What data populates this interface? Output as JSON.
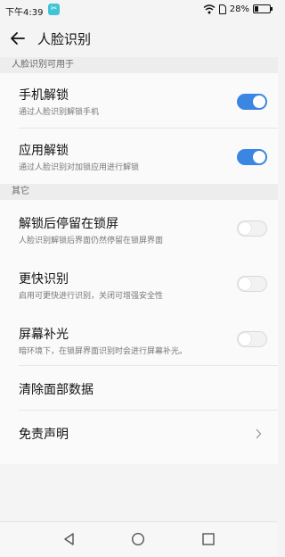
{
  "status_bar": {
    "time": "下午4:39",
    "app_icon_glyph": "✂",
    "battery_percent_text": "28%",
    "battery_level": 0.28
  },
  "header": {
    "title": "人脸识别"
  },
  "sections": [
    {
      "header": "人脸识别可用于"
    },
    {
      "header": "其它"
    }
  ],
  "rows": {
    "phone_unlock": {
      "title": "手机解锁",
      "subtitle": "通过人脸识别解锁手机",
      "enabled": true
    },
    "app_unlock": {
      "title": "应用解锁",
      "subtitle": "通过人脸识别对加锁应用进行解锁",
      "enabled": true
    },
    "stay_on_lockscreen": {
      "title": "解锁后停留在锁屏",
      "subtitle": "人脸识别解锁后界面仍然停留在锁屏界面",
      "enabled": false
    },
    "faster_recognition": {
      "title": "更快识别",
      "subtitle": "启用可更快进行识别，关闭可增强安全性",
      "enabled": false
    },
    "screen_fill_light": {
      "title": "屏幕补光",
      "subtitle": "暗环境下，在锁屏界面识别时会进行屏幕补光。",
      "enabled": false
    },
    "clear_face_data": {
      "title": "清除面部数据"
    },
    "disclaimer": {
      "title": "免责声明"
    }
  },
  "icons": {
    "back": "back-arrow-icon",
    "wifi": "wifi-icon",
    "sim": "sim-card-icon",
    "battery": "battery-icon",
    "chevron": "chevron-right-icon"
  },
  "colors": {
    "toggle_on": "#3a86e2",
    "background": "#f4f4f4"
  }
}
